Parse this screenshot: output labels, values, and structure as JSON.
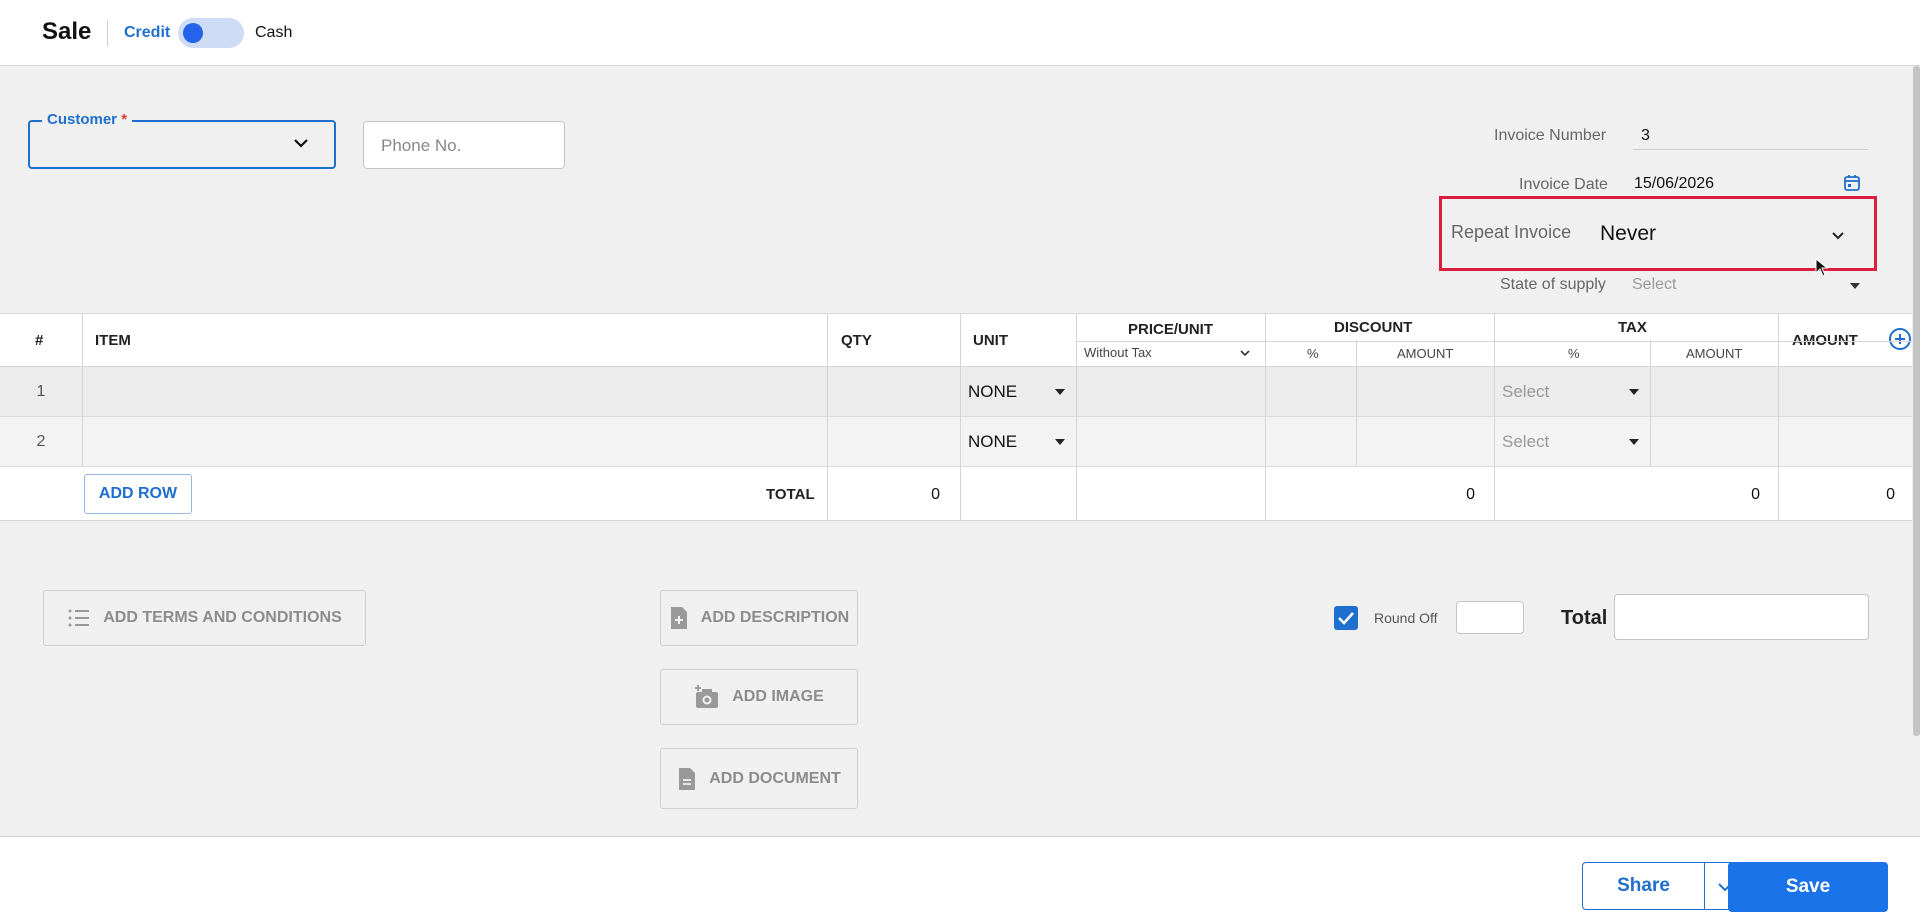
{
  "header": {
    "title": "Sale",
    "credit_label": "Credit",
    "cash_label": "Cash"
  },
  "customer": {
    "label": "Customer",
    "required_mark": "*",
    "phone_placeholder": "Phone No."
  },
  "invoice": {
    "number_label": "Invoice Number",
    "number": "3",
    "date_label": "Invoice Date",
    "date": "15/06/2026",
    "repeat_label": "Repeat Invoice",
    "repeat_value": "Never",
    "supply_label": "State of supply",
    "supply_value": "Select"
  },
  "table": {
    "headers": {
      "num": "#",
      "item": "ITEM",
      "qty": "QTY",
      "unit": "UNIT",
      "price": "PRICE/UNIT",
      "price_sub": "Without Tax",
      "discount": "DISCOUNT",
      "discount_pct": "%",
      "discount_amt": "AMOUNT",
      "tax": "TAX",
      "tax_pct": "%",
      "tax_amt": "AMOUNT",
      "amount": "AMOUNT"
    },
    "rows": [
      {
        "num": "1",
        "unit": "NONE",
        "tax": "Select"
      },
      {
        "num": "2",
        "unit": "NONE",
        "tax": "Select"
      }
    ],
    "add_row": "ADD ROW",
    "total_label": "TOTAL",
    "total_qty": "0",
    "total_discount": "0",
    "total_tax": "0",
    "total_amount": "0"
  },
  "actions": {
    "terms": "ADD TERMS AND CONDITIONS",
    "description": "ADD DESCRIPTION",
    "image": "ADD IMAGE",
    "document": "ADD DOCUMENT",
    "round_off": "Round Off",
    "total_label": "Total"
  },
  "footer": {
    "share": "Share",
    "save": "Save"
  },
  "colors": {
    "accent": "#1f6fcf",
    "highlight": "#dc1f3e",
    "save": "#1a73e8"
  }
}
